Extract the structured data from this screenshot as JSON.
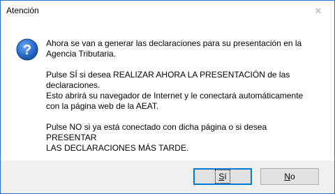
{
  "window": {
    "title": "Atención",
    "close_glyph": "✕"
  },
  "icon": {
    "name": "question-icon",
    "glyph": "?",
    "color": "#1f5fb8"
  },
  "message": {
    "p1": "Ahora se van a generar las declaraciones para su presentación en la\nAgencia Tributaria.",
    "p2": "Pulse SÍ si desea REALIZAR AHORA LA PRESENTACIÓN de las\ndeclaraciones.\nEsto abrirá su navegador de Internet y le conectará automáticamente\ncon la página web de la AEAT.",
    "p3": "Pulse NO si ya está conectado con dicha página o si desea PRESENTAR\nLAS DECLARACIONES MÁS TARDE."
  },
  "buttons": {
    "yes": {
      "access_key": "S",
      "rest": "í"
    },
    "no": {
      "access_key": "N",
      "rest": "o"
    }
  }
}
